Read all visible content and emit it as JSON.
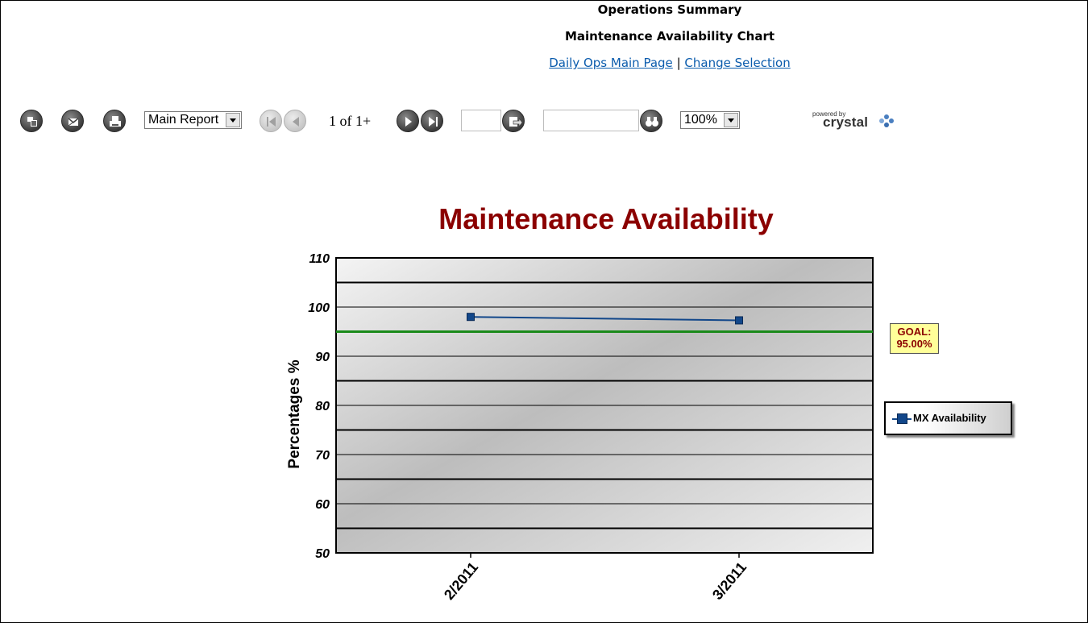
{
  "header": {
    "title": "Operations Summary",
    "subtitle": "Maintenance Availability Chart",
    "link_main": "Daily Ops Main Page",
    "separator": "|",
    "link_change": "Change Selection"
  },
  "toolbar": {
    "report_select": "Main Report",
    "page_info": "1 of 1+",
    "zoom_select": "100%",
    "powered_by": "powered by",
    "brand": "crystal"
  },
  "icons": {
    "export": "export-icon",
    "mail": "mail-icon",
    "print": "print-icon",
    "first": "first-page-icon",
    "prev": "previous-page-icon",
    "next": "next-page-icon",
    "last": "last-page-icon",
    "goto": "go-to-page-icon",
    "search": "binoculars-search-icon"
  },
  "chart_data": {
    "type": "line",
    "title": "Maintenance Availability",
    "ylabel": "Percentages %",
    "xlabel": "",
    "categories": [
      "2/2011",
      "3/2011"
    ],
    "series": [
      {
        "name": "MX Availability",
        "values": [
          98.0,
          97.3
        ],
        "color": "#12478a"
      }
    ],
    "ylim": [
      50,
      110
    ],
    "yticks": [
      50,
      60,
      70,
      80,
      90,
      100,
      110
    ],
    "goal": {
      "value": 95,
      "label_line1": "GOAL:",
      "label_line2": "95.00%",
      "color": "#1a8a1a"
    },
    "title_color": "#8b0000",
    "grid": true,
    "legend": "right"
  }
}
